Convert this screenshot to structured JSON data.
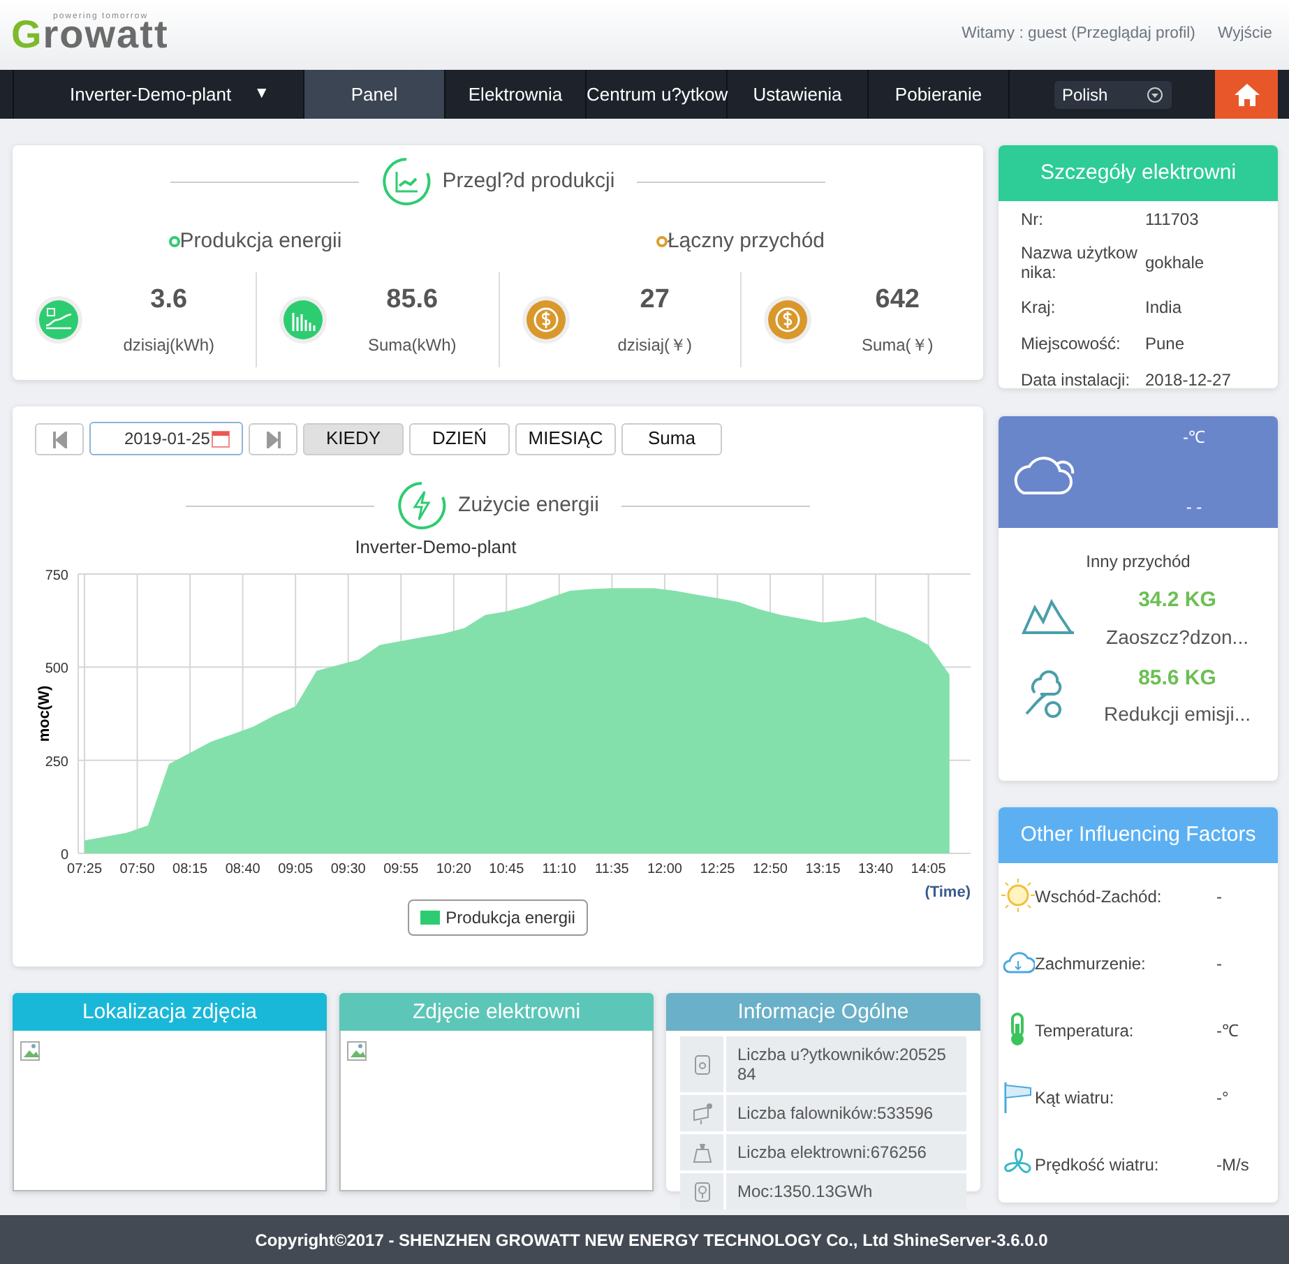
{
  "header": {
    "logo": "Growatt",
    "logo_tagline": "powering tomorrow",
    "greeting": "Witamy : guest (Przeglądaj profil)",
    "logout": "Wyjście"
  },
  "nav": {
    "plant_selector": "Inverter-Demo-plant",
    "plant_caret": "▼",
    "items": [
      {
        "label": "Panel",
        "selected": true
      },
      {
        "label": "Elektrownia",
        "selected": false
      },
      {
        "label": "Centrum u?ytkow",
        "selected": false
      },
      {
        "label": "Ustawienia",
        "selected": false
      },
      {
        "label": "Pobieranie",
        "selected": false
      }
    ],
    "language": "Polish"
  },
  "production": {
    "title": "Przegl?d produkcji",
    "groups": [
      {
        "label": "Produkcja energii",
        "color": "#2ecc71",
        "stats": [
          {
            "value": "3.6",
            "unit": "dzisiaj(kWh)",
            "kind": "line"
          },
          {
            "value": "85.6",
            "unit": "Suma(kWh)",
            "kind": "bars"
          }
        ]
      },
      {
        "label": "Łączny przychód",
        "color": "#d9a030",
        "stats": [
          {
            "value": "27",
            "unit": "dzisiaj(￥)",
            "kind": "coin"
          },
          {
            "value": "642",
            "unit": "Suma(￥)",
            "kind": "coin"
          }
        ]
      }
    ]
  },
  "energy_chart": {
    "date": "2019-01-25",
    "periods": [
      {
        "label": "KIEDY",
        "selected": true
      },
      {
        "label": "DZIEŃ",
        "selected": false
      },
      {
        "label": "MIESIĄC",
        "selected": false
      },
      {
        "label": "Suma",
        "selected": false
      }
    ],
    "title": "Zużycie energii",
    "chart_data": {
      "type": "area",
      "title": "Inverter-Demo-plant",
      "xlabel": "(Time)",
      "ylabel": "moc(W)",
      "x": [
        445,
        455,
        465,
        475,
        485,
        495,
        505,
        515,
        525,
        535,
        545,
        555,
        565,
        575,
        585,
        595,
        605,
        615,
        625,
        635,
        645,
        655,
        665,
        675,
        685,
        695,
        705,
        715,
        725,
        735,
        745,
        755,
        765,
        775,
        785,
        795,
        805,
        815,
        825,
        835,
        845,
        855
      ],
      "series": [
        {
          "name": "Produkcja energii",
          "color": "#84e0ab",
          "values": [
            35,
            45,
            55,
            75,
            240,
            270,
            300,
            320,
            340,
            370,
            395,
            490,
            505,
            520,
            560,
            570,
            580,
            590,
            605,
            640,
            650,
            665,
            685,
            705,
            710,
            712,
            712,
            712,
            705,
            695,
            685,
            675,
            655,
            640,
            630,
            620,
            625,
            635,
            610,
            590,
            560,
            480
          ]
        }
      ],
      "xlim": [
        442,
        865
      ],
      "ylim": [
        0,
        750
      ],
      "grid": true,
      "yticks": [
        0,
        250,
        500,
        750
      ],
      "xticks": [
        {
          "value": 445,
          "label": "07:25"
        },
        {
          "value": 470,
          "label": "07:50"
        },
        {
          "value": 495,
          "label": "08:15"
        },
        {
          "value": 520,
          "label": "08:40"
        },
        {
          "value": 545,
          "label": "09:05"
        },
        {
          "value": 570,
          "label": "09:30"
        },
        {
          "value": 595,
          "label": "09:55"
        },
        {
          "value": 620,
          "label": "10:20"
        },
        {
          "value": 645,
          "label": "10:45"
        },
        {
          "value": 670,
          "label": "11:10"
        },
        {
          "value": 695,
          "label": "11:35"
        },
        {
          "value": 720,
          "label": "12:00"
        },
        {
          "value": 745,
          "label": "12:25"
        },
        {
          "value": 770,
          "label": "12:50"
        },
        {
          "value": 795,
          "label": "13:15"
        },
        {
          "value": 820,
          "label": "13:40"
        },
        {
          "value": 845,
          "label": "14:05"
        }
      ]
    }
  },
  "photo_panels": [
    {
      "title": "Lokalizacja zdjęcia",
      "color": "#1ab8d8"
    },
    {
      "title": "Zdjęcie elektrowni",
      "color": "#5cc6b8"
    }
  ],
  "general_info": {
    "title": "Informacje Ogólne",
    "rows": [
      {
        "text": "Liczba u?ytkowników:2052584",
        "kind": "users"
      },
      {
        "text": "Liczba falowników:533596",
        "kind": "inverters"
      },
      {
        "text": "Liczba elektrowni:676256",
        "kind": "plants"
      },
      {
        "text": "Moc:1350.13GWh",
        "kind": "power"
      }
    ]
  },
  "plant_details": {
    "title": "Szczegóły elektrowni",
    "rows": [
      {
        "label": "Nr:",
        "value": "111703"
      },
      {
        "label": "Nazwa użytkownika:",
        "value": "gokhale"
      },
      {
        "label": "Kraj:",
        "value": "India"
      },
      {
        "label": "Miejscowość:",
        "value": "Pune"
      },
      {
        "label": "Data instalacji:",
        "value": "2018-12-27"
      }
    ]
  },
  "weather": {
    "temperature": "-℃",
    "condition": "- -",
    "other_title": "Inny przychód",
    "savings": [
      {
        "value": "34.2 KG",
        "label": "Zaoszcz?dzon...",
        "kind": "coal"
      },
      {
        "value": "85.6 KG",
        "label": "Redukcji emisji...",
        "kind": "co2"
      }
    ]
  },
  "factors": {
    "title": "Other Influencing Factors",
    "rows": [
      {
        "label": "Wschód-Zachód:",
        "value": "-",
        "kind": "sun"
      },
      {
        "label": "Zachmurzenie:",
        "value": "-",
        "kind": "cloud"
      },
      {
        "label": "Temperatura:",
        "value": "-℃",
        "kind": "temperature"
      },
      {
        "label": "Kąt wiatru:",
        "value": "-°",
        "kind": "wind_direction"
      },
      {
        "label": "Prędkość wiatru:",
        "value": "-M/s",
        "kind": "wind_speed"
      }
    ]
  },
  "footer": "Copyright©2017 - SHENZHEN GROWATT NEW ENERGY TECHNOLOGY Co., Ltd ShineServer-3.6.0.0"
}
